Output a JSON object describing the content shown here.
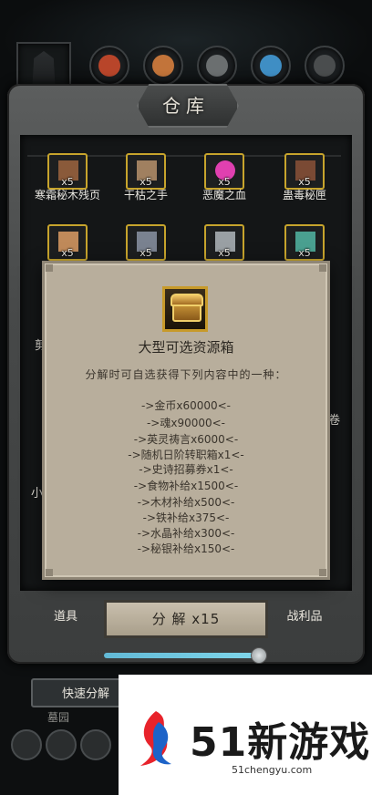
{
  "window": {
    "title": "仓库"
  },
  "top_slots": [
    {
      "icon": "character-icon"
    },
    {
      "icon": "gear-slot-red-icon",
      "color": "#b8452a"
    },
    {
      "icon": "gear-slot-orange-icon",
      "color": "#c2743a"
    },
    {
      "icon": "gear-slot-grey-icon",
      "color": "#6b6f70"
    },
    {
      "icon": "gear-slot-blue-icon",
      "color": "#3f8ec4"
    },
    {
      "icon": "gear-slot-dark-icon",
      "color": "#4a4d4e"
    }
  ],
  "items_row1": [
    {
      "label": "寒霜秘木残页",
      "qty": "x5",
      "icon": "frost-page-icon",
      "color": "#8a5a3a"
    },
    {
      "label": "干枯之手",
      "qty": "x5",
      "icon": "withered-hand-icon",
      "color": "#a08060"
    },
    {
      "label": "恶魔之血",
      "qty": "x5",
      "icon": "demon-blood-icon",
      "color": "#e040b0"
    },
    {
      "label": "蛊毒秘匣",
      "qty": "x5",
      "icon": "poison-box-icon",
      "color": "#7a4a34"
    }
  ],
  "items_row2": [
    {
      "qty": "x5",
      "icon": "bone-doll-icon",
      "color": "#c08a5a"
    },
    {
      "qty": "x5",
      "icon": "iron-ore-icon",
      "color": "#7a8290"
    },
    {
      "qty": "x5",
      "icon": "scroll-icon",
      "color": "#9aa0a4"
    },
    {
      "qty": "x5",
      "icon": "crystal-icon",
      "color": "#4aa090"
    }
  ],
  "side_fragments": {
    "left_a": "剪",
    "left_b": "小",
    "right": "卷"
  },
  "modal": {
    "icon": "treasure-chest-icon",
    "title": "大型可选资源箱",
    "description": "分解时可自选获得下列内容中的一种：",
    "rewards": [
      "->金币x60000<-",
      "->魂x90000<-",
      "->英灵祷言x6000<-",
      "->随机日阶转职箱x1<-",
      "->史诗招募券x1<-",
      "->食物补给x1500<-",
      "->木材补给x500<-",
      "->铁补给x375<-",
      "->水晶补给x300<-",
      "->秘银补给x150<-"
    ]
  },
  "tabs": {
    "items": "道具",
    "decompose": "分 解 x15",
    "loot": "战利品"
  },
  "progress": {
    "value": 0.97
  },
  "quick_decompose": "快速分解",
  "bottom_label": "墓园",
  "watermark": {
    "brand": "51新游戏",
    "url": "51chengyu.com"
  }
}
